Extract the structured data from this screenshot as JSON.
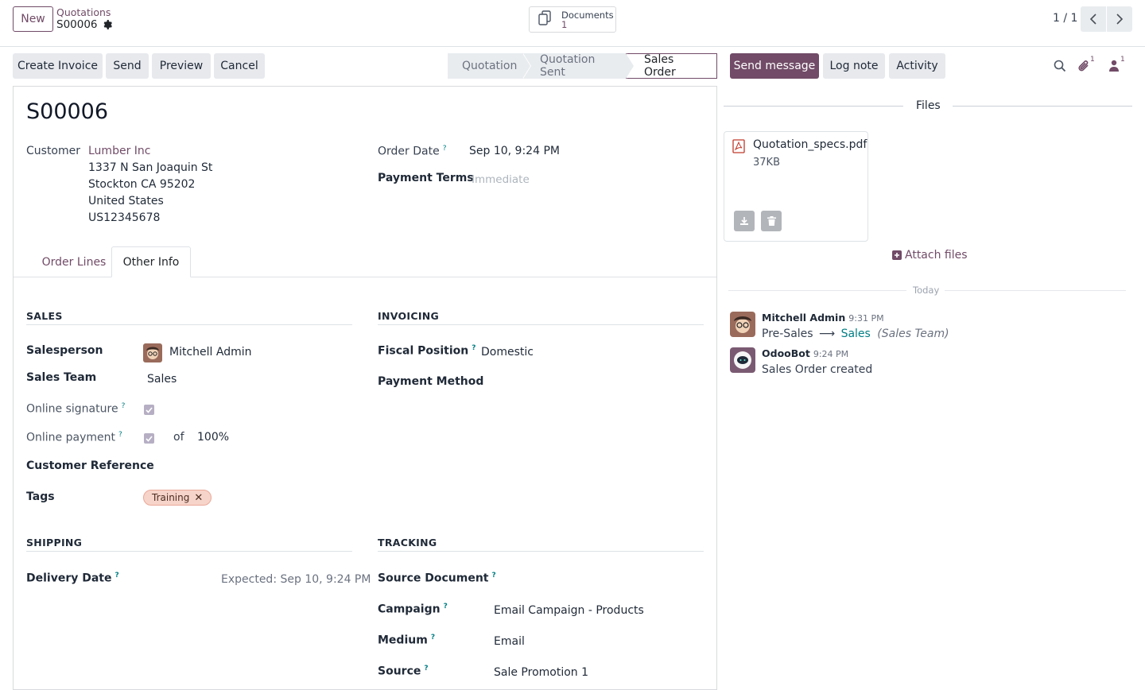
{
  "topbar": {
    "new_label": "New",
    "breadcrumb_parent": "Quotations",
    "breadcrumb_current": "S00006",
    "documents_label": "Documents",
    "documents_count": "1",
    "pager": "1 / 1"
  },
  "actions": {
    "create_invoice": "Create Invoice",
    "send": "Send",
    "preview": "Preview",
    "cancel": "Cancel"
  },
  "statusbar": {
    "stages": [
      "Quotation",
      "Quotation Sent",
      "Sales Order"
    ],
    "active": "Sales Order"
  },
  "chatter_buttons": {
    "send_message": "Send message",
    "log_note": "Log note",
    "activity": "Activity",
    "attachments_count": "1",
    "followers_count": "1"
  },
  "form": {
    "title": "S00006",
    "customer_label": "Customer",
    "customer_name": "Lumber Inc",
    "address": [
      "1337 N San Joaquin St",
      "Stockton CA 95202",
      "United States",
      "US12345678"
    ],
    "order_date_label": "Order Date",
    "order_date_help": "?",
    "order_date": "Sep 10, 9:24 PM",
    "payment_terms_label": "Payment Terms",
    "payment_terms_placeholder": "Immediate"
  },
  "tabs": {
    "order_lines": "Order Lines",
    "other_info": "Other Info"
  },
  "sales": {
    "heading": "SALES",
    "salesperson_label": "Salesperson",
    "salesperson": "Mitchell Admin",
    "sales_team_label": "Sales Team",
    "sales_team": "Sales",
    "online_signature_label": "Online signature",
    "online_payment_label": "Online payment",
    "of_label": "of",
    "prepayment": "100%",
    "customer_reference_label": "Customer Reference",
    "tags_label": "Tags",
    "tag": "Training"
  },
  "invoicing": {
    "heading": "INVOICING",
    "fiscal_position_label": "Fiscal Position",
    "fiscal_position": "Domestic",
    "payment_method_label": "Payment Method"
  },
  "shipping": {
    "heading": "SHIPPING",
    "delivery_date_label": "Delivery Date",
    "delivery_expected": "Expected: Sep 10, 9:24 PM"
  },
  "tracking": {
    "heading": "TRACKING",
    "source_document_label": "Source Document",
    "campaign_label": "Campaign",
    "campaign": "Email Campaign - Products",
    "medium_label": "Medium",
    "medium": "Email",
    "source_label": "Source",
    "source": "Sale Promotion 1"
  },
  "chatter": {
    "files_title": "Files",
    "file_name": "Quotation_specs.pdf",
    "file_size": "37KB",
    "attach_label": "Attach files",
    "today_label": "Today",
    "messages": [
      {
        "author": "Mitchell Admin",
        "time": "9:31 PM",
        "from": "Pre-Sales",
        "arrow": "⟶",
        "to": "Sales",
        "field": "(Sales Team)"
      },
      {
        "author": "OdooBot",
        "time": "9:24 PM",
        "body": "Sales Order created"
      }
    ]
  },
  "colors": {
    "primary": "#714b67",
    "teal": "#017e84",
    "tag_bg": "#f7d4c9"
  }
}
